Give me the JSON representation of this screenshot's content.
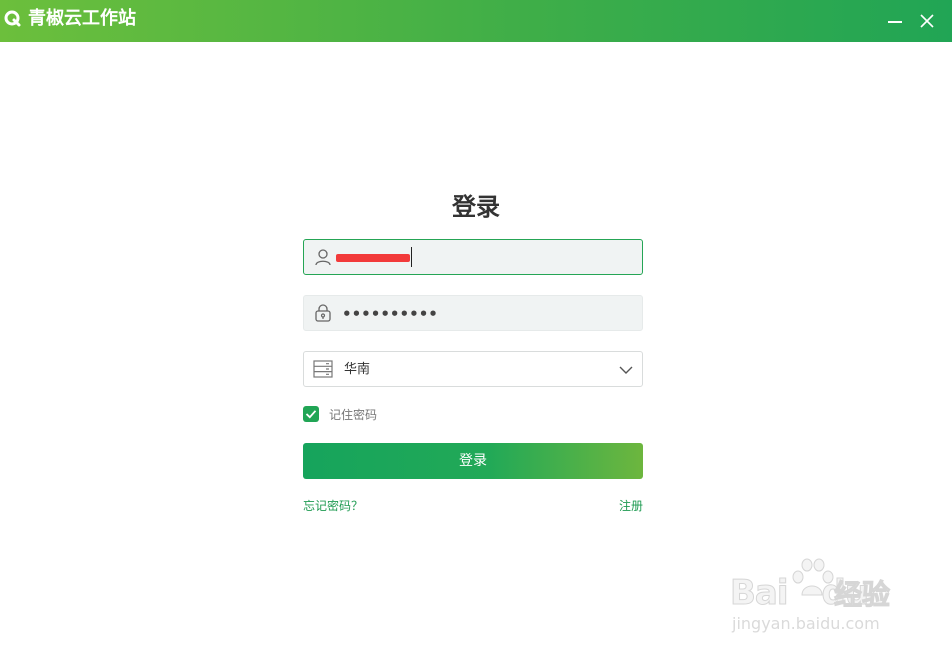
{
  "window": {
    "title": "青椒云工作站",
    "logo_icon": "q-logo-icon",
    "minimize_icon": "minimize-icon",
    "close_icon": "close-icon",
    "accent_start": "#6cbf3c",
    "accent_end": "#21a555"
  },
  "login": {
    "heading": "登录",
    "username": {
      "icon": "user-icon",
      "value_redacted": true
    },
    "password": {
      "icon": "lock-icon",
      "masked_value": "••••••••••"
    },
    "region": {
      "icon": "server-icon",
      "selected": "华南",
      "dropdown_icon": "chevron-down-icon"
    },
    "remember": {
      "checked": true,
      "label": "记住密码"
    },
    "submit_label": "登录",
    "forgot_label": "忘记密码？",
    "register_label": "注册"
  },
  "watermark": {
    "brand": "Bai",
    "brand_suffix": "du",
    "cn": "经验",
    "url": "jingyan.baidu.com"
  }
}
